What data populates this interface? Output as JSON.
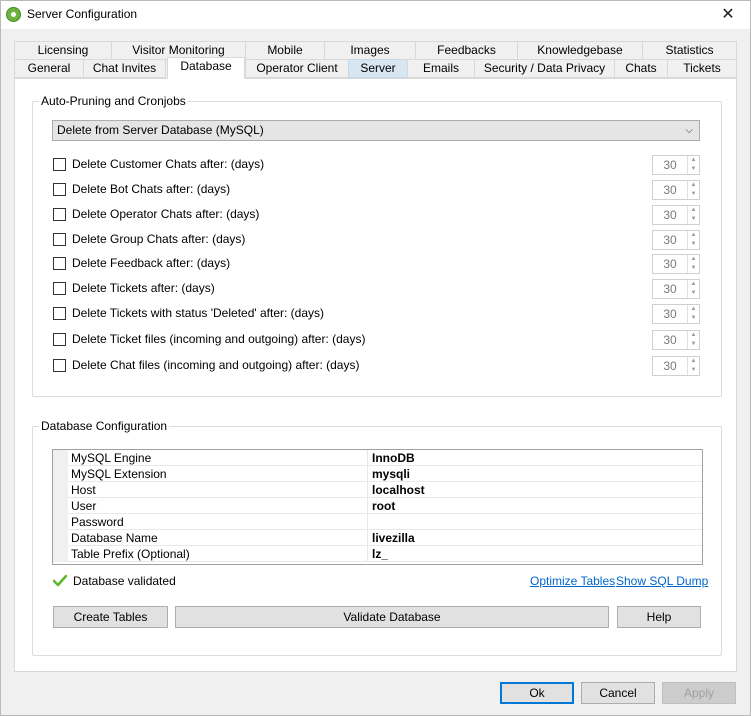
{
  "window": {
    "title": "Server Configuration",
    "close_glyph": "✕"
  },
  "tabs_back": [
    {
      "label": "Licensing"
    },
    {
      "label": "Visitor Monitoring"
    },
    {
      "label": "Mobile"
    },
    {
      "label": "Images"
    },
    {
      "label": "Feedbacks"
    },
    {
      "label": "Knowledgebase"
    },
    {
      "label": "Statistics"
    }
  ],
  "tabs_front": [
    {
      "label": "General"
    },
    {
      "label": "Chat Invites"
    },
    {
      "label": "Database"
    },
    {
      "label": "Operator Client"
    },
    {
      "label": "Server"
    },
    {
      "label": "Emails"
    },
    {
      "label": "Security / Data Privacy"
    },
    {
      "label": "Chats"
    },
    {
      "label": "Tickets"
    }
  ],
  "active_tab": "Database",
  "pruning": {
    "legend": "Auto-Pruning and Cronjobs",
    "mode_selected": "Delete from Server Database (MySQL)",
    "rows": [
      {
        "label": "Delete Customer Chats after: (days)",
        "checked": false,
        "value": "30"
      },
      {
        "label": "Delete Bot Chats after: (days)",
        "checked": false,
        "value": "30"
      },
      {
        "label": "Delete Operator Chats after: (days)",
        "checked": false,
        "value": "30"
      },
      {
        "label": "Delete Group Chats after: (days)",
        "checked": false,
        "value": "30"
      },
      {
        "label": "Delete Feedback after: (days)",
        "checked": false,
        "value": "30"
      },
      {
        "label": "Delete Tickets after: (days)",
        "checked": false,
        "value": "30"
      },
      {
        "label": "Delete Tickets with status 'Deleted' after: (days)",
        "checked": false,
        "value": "30"
      },
      {
        "label": "Delete Ticket files (incoming and outgoing) after: (days)",
        "checked": false,
        "value": "30"
      },
      {
        "label": "Delete Chat files (incoming and outgoing) after: (days)",
        "checked": false,
        "value": "30"
      }
    ]
  },
  "dbconfig": {
    "legend": "Database Configuration",
    "properties": [
      {
        "name": "MySQL Engine",
        "value": "InnoDB"
      },
      {
        "name": "MySQL Extension",
        "value": "mysqli"
      },
      {
        "name": "Host",
        "value": "localhost"
      },
      {
        "name": "User",
        "value": "root"
      },
      {
        "name": "Password",
        "value": ""
      },
      {
        "name": "Database Name",
        "value": "livezilla"
      },
      {
        "name": "Table Prefix (Optional)",
        "value": "lz_"
      }
    ],
    "status_text": "Database validated",
    "link_optimize": "Optimize Tables",
    "link_dump": "Show SQL Dump",
    "btn_create": "Create Tables",
    "btn_validate": "Validate Database",
    "btn_help": "Help"
  },
  "footer": {
    "ok": "Ok",
    "cancel": "Cancel",
    "apply": "Apply"
  },
  "colors": {
    "accent": "#0078d7",
    "link": "#0066cc",
    "check_green": "#5cb82e"
  }
}
